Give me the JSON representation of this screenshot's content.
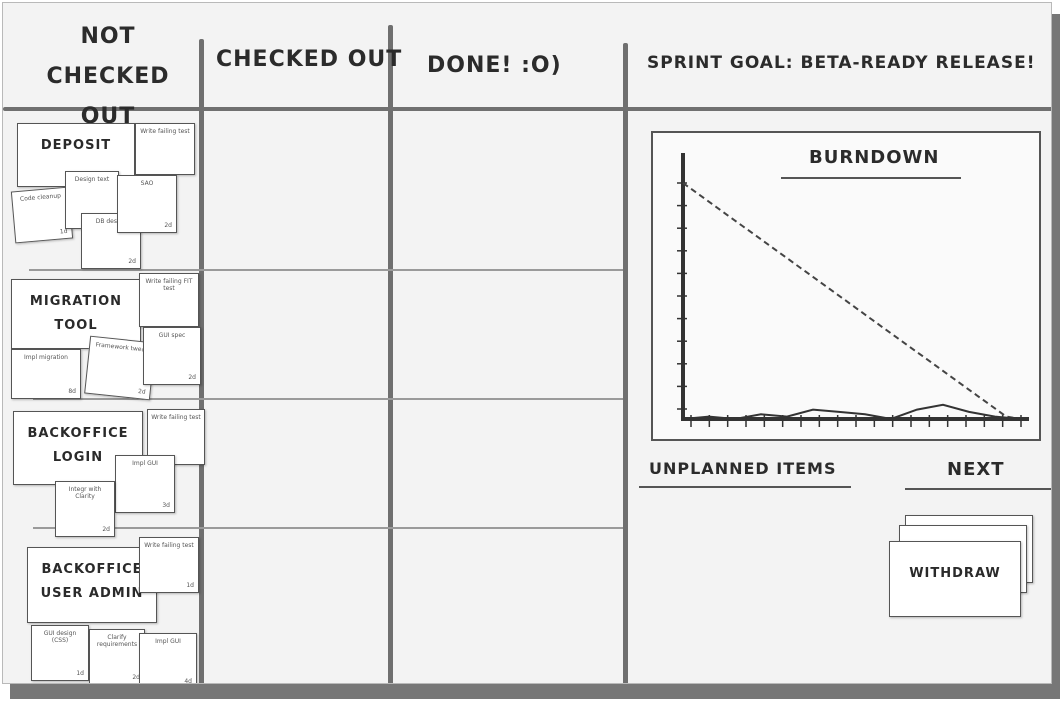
{
  "columns": {
    "not_checked_out": "Not checked out",
    "checked_out": "Checked out",
    "done": "Done! :o)",
    "sprint_goal": "Sprint goal: Beta-ready release!"
  },
  "stories": [
    {
      "name": "Deposit",
      "tasks": [
        {
          "text": "Write failing test",
          "est": ""
        },
        {
          "text": "Code cleanup",
          "est": "1d"
        },
        {
          "text": "Design text",
          "est": ""
        },
        {
          "text": "SAO",
          "est": "2d"
        },
        {
          "text": "DB design",
          "est": "2d"
        }
      ]
    },
    {
      "name": "Migration tool",
      "tasks": [
        {
          "text": "Write failing FIT test",
          "est": ""
        },
        {
          "text": "Impl migration",
          "est": "8d"
        },
        {
          "text": "Framework tweak",
          "est": "2d"
        },
        {
          "text": "GUI spec",
          "est": "2d"
        }
      ]
    },
    {
      "name": "Backoffice Login",
      "tasks": [
        {
          "text": "Write failing test",
          "est": ""
        },
        {
          "text": "Impl GUI",
          "est": "3d"
        },
        {
          "text": "Integr with Clarity",
          "est": "2d"
        }
      ]
    },
    {
      "name": "Backoffice User admin",
      "tasks": [
        {
          "text": "Write failing test",
          "est": "1d"
        },
        {
          "text": "GUI design (CSS)",
          "est": "1d"
        },
        {
          "text": "Clarify requirements",
          "est": "2d"
        },
        {
          "text": "Impl GUI",
          "est": "4d"
        }
      ]
    }
  ],
  "burndown": {
    "title": "Burndown",
    "x_tick_count": 19,
    "y_tick_count": 11
  },
  "chart_data": {
    "type": "line",
    "title": "Burndown",
    "series": [
      {
        "name": "",
        "style": "dashed",
        "values": [
          1.0,
          0.955,
          0.91,
          0.865,
          0.82,
          0.775,
          0.73,
          0.685,
          0.64,
          0.595,
          0.55,
          0.505,
          0.46,
          0.415,
          0.37,
          0.325,
          0.28,
          0.235,
          0.19,
          0.145,
          0.1,
          0.055,
          0.01,
          0.0
        ]
      },
      {
        "name": "",
        "style": "solid",
        "values": [
          0.0,
          0.01,
          0.0,
          0.02,
          0.01,
          0.04,
          0.03,
          0.02,
          0.0,
          0.04,
          0.06,
          0.03,
          0.01,
          0.0
        ]
      }
    ]
  },
  "unplanned_items": "Unplanned items",
  "next": {
    "label": "Next",
    "card": "Withdraw"
  },
  "colors": {
    "board": "#f3f3f3",
    "line": "#6f6f6f",
    "note": "#ffffff"
  }
}
